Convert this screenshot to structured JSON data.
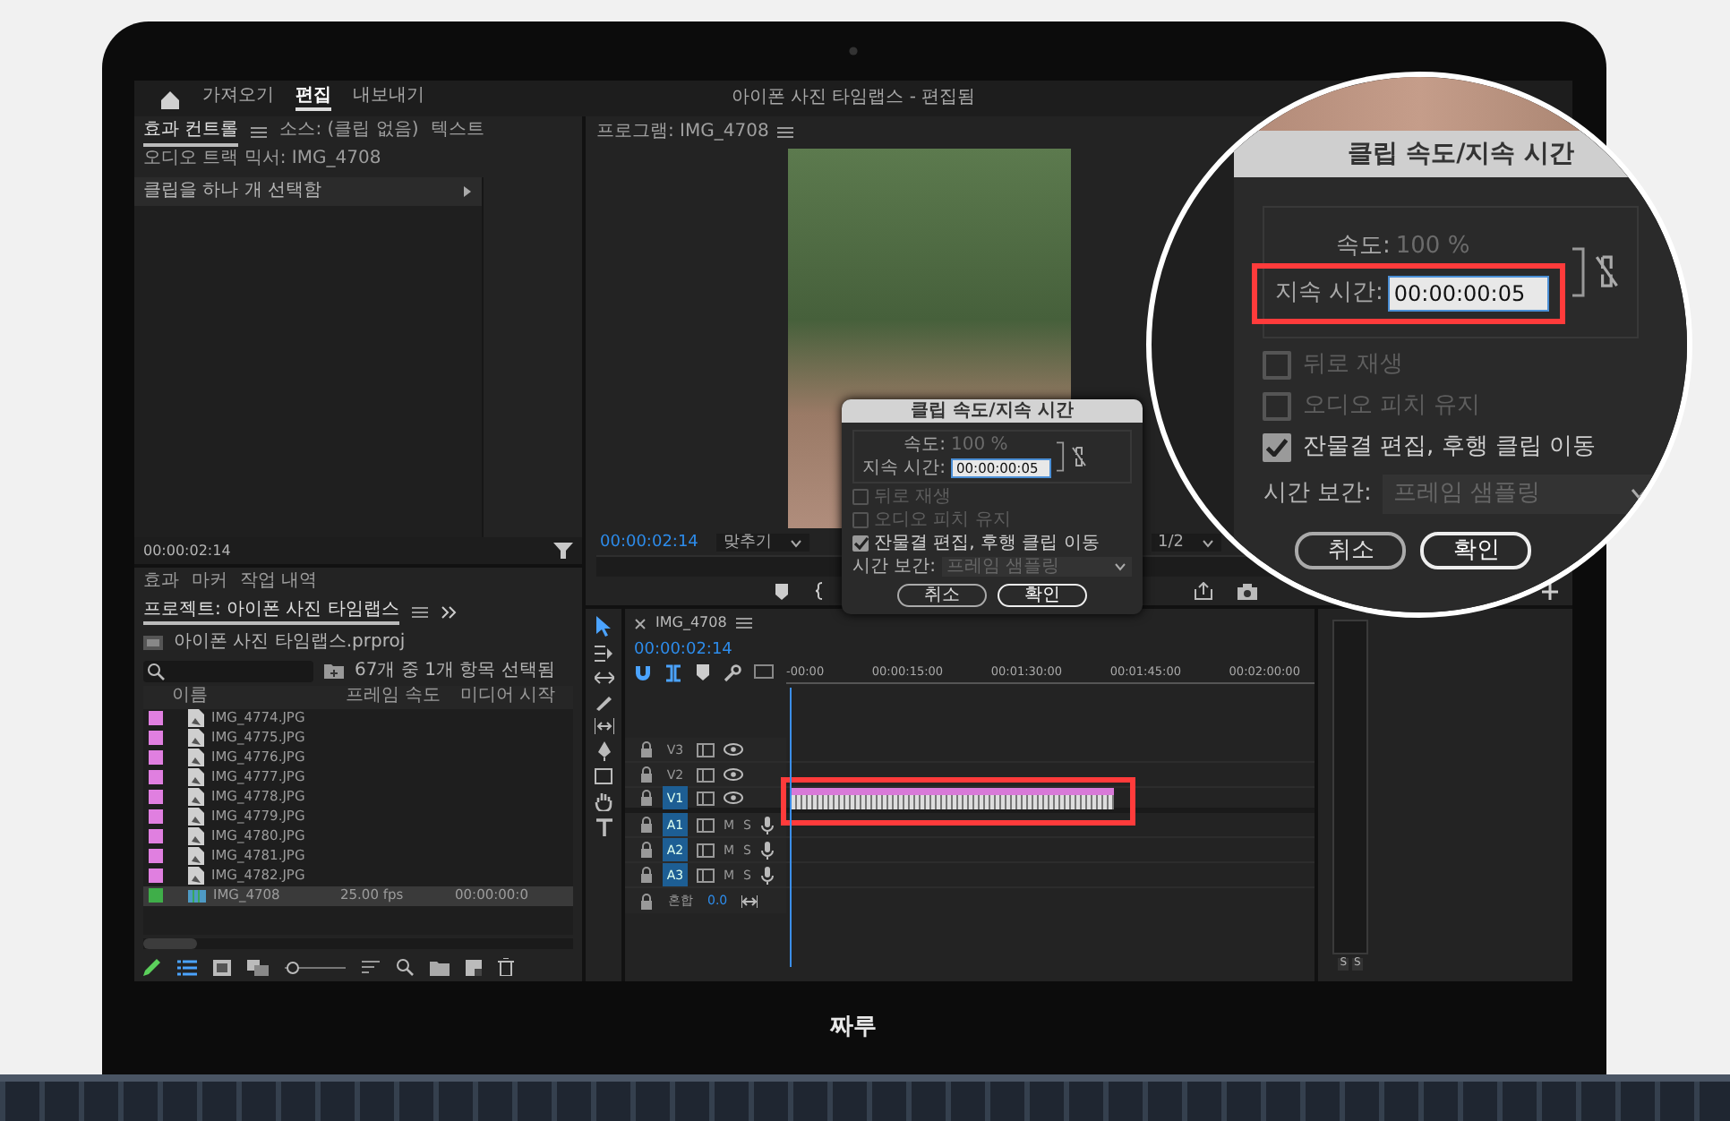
{
  "menu_bar": {
    "tabs": [
      {
        "label": "가져오기",
        "selected": false
      },
      {
        "label": "편집",
        "selected": true
      },
      {
        "label": "내보내기",
        "selected": false
      }
    ],
    "title": "아이폰 사진 타임랩스 - 편집됨"
  },
  "effect_controls": {
    "tabs": [
      {
        "label": "효과 컨트롤",
        "selected": true
      },
      {
        "label": "소스: (클립 없음)",
        "selected": false
      },
      {
        "label": "텍스트",
        "selected": false
      },
      {
        "label": "오디오 트랙 믹서: IMG_4708",
        "selected": false
      }
    ],
    "message": "클립을 하나 개 선택함",
    "timecode": "00:00:02:14"
  },
  "program_monitor": {
    "title": "프로그램: IMG_4708",
    "timecode": "00:00:02:14",
    "fit": "맞추기",
    "resolution": "1/2"
  },
  "project_panel": {
    "tabs": [
      {
        "label": "효과",
        "selected": false
      },
      {
        "label": "마커",
        "selected": false
      },
      {
        "label": "작업 내역",
        "selected": false
      },
      {
        "label": "프로젝트: 아이폰 사진 타임랩스",
        "selected": true
      }
    ],
    "file": "아이폰 사진 타임랩스.prproj",
    "selection_info": "67개 중 1개 항목 선택됨",
    "columns": [
      "이름",
      "프레임 속도",
      "미디어 시작"
    ],
    "items": [
      {
        "name": "IMG_4774.JPG",
        "kind": "image",
        "color": "#e07fe0",
        "selected": false
      },
      {
        "name": "IMG_4775.JPG",
        "kind": "image",
        "color": "#e07fe0",
        "selected": false
      },
      {
        "name": "IMG_4776.JPG",
        "kind": "image",
        "color": "#e07fe0",
        "selected": false
      },
      {
        "name": "IMG_4777.JPG",
        "kind": "image",
        "color": "#e07fe0",
        "selected": false
      },
      {
        "name": "IMG_4778.JPG",
        "kind": "image",
        "color": "#e07fe0",
        "selected": false
      },
      {
        "name": "IMG_4779.JPG",
        "kind": "image",
        "color": "#e07fe0",
        "selected": false
      },
      {
        "name": "IMG_4780.JPG",
        "kind": "image",
        "color": "#e07fe0",
        "selected": false
      },
      {
        "name": "IMG_4781.JPG",
        "kind": "image",
        "color": "#e07fe0",
        "selected": false
      },
      {
        "name": "IMG_4782.JPG",
        "kind": "image",
        "color": "#e07fe0",
        "selected": false
      },
      {
        "name": "IMG_4708",
        "kind": "sequence",
        "color": "#3fae49",
        "selected": true,
        "frame_rate": "25.00 fps",
        "media_start": "00:00:00:0"
      }
    ],
    "zoom_slider": {
      "level": 0.05
    }
  },
  "timeline": {
    "title": "IMG_4708",
    "timecode": "00:00:02:14",
    "ruler": [
      "-00:00",
      "00:00:15:00",
      "00:01:30:00",
      "00:01:45:00",
      "00:02:00:00"
    ],
    "tracks": [
      {
        "label": "V3",
        "kind": "video",
        "selected": false,
        "clip": false
      },
      {
        "label": "V2",
        "kind": "video",
        "selected": false,
        "clip": false
      },
      {
        "label": "V1",
        "kind": "video",
        "selected": true,
        "clip": true
      },
      {
        "label": "A1",
        "kind": "audio",
        "selected": true,
        "clip": false,
        "mute": "M",
        "solo": "S"
      },
      {
        "label": "A2",
        "kind": "audio",
        "selected": true,
        "clip": false,
        "mute": "M",
        "solo": "S"
      },
      {
        "label": "A3",
        "kind": "audio",
        "selected": true,
        "clip": false,
        "mute": "M",
        "solo": "S"
      }
    ],
    "mix": {
      "label": "혼합",
      "value": "0.0"
    },
    "meter_labels": [
      "S",
      "S"
    ]
  },
  "speed_dialog": {
    "title": "클립 속도/지속 시간",
    "speed_label": "속도:",
    "speed": "100 %",
    "duration_label": "지속 시간:",
    "duration": "00:00:00:05",
    "options": [
      {
        "label": "뒤로 재생",
        "checked": false
      },
      {
        "label": "오디오 피치 유지",
        "checked": false
      },
      {
        "label": "잔물결 편집, 후행 클립 이동",
        "checked": true
      }
    ],
    "interpolation_label": "시간 보간:",
    "interpolation": "프레임 샘플링",
    "buttons": [
      "취소",
      "확인"
    ]
  },
  "magnifier": {
    "title": "클립 속도/지속 시간",
    "speed_label": "속도:",
    "speed": "100 %",
    "duration_label": "지속 시간:",
    "duration": "00:00:00:05",
    "options": [
      {
        "label": "뒤로 재생",
        "checked": false
      },
      {
        "label": "오디오 피치 유지",
        "checked": false
      },
      {
        "label": "잔물결 편집, 후행 클립 이동",
        "checked": true
      }
    ],
    "interpolation_label": "시간 보간:",
    "interpolation": "프레임 샘플링",
    "buttons": [
      "취소",
      "확인"
    ]
  },
  "laptop": {
    "label": "짜루"
  }
}
